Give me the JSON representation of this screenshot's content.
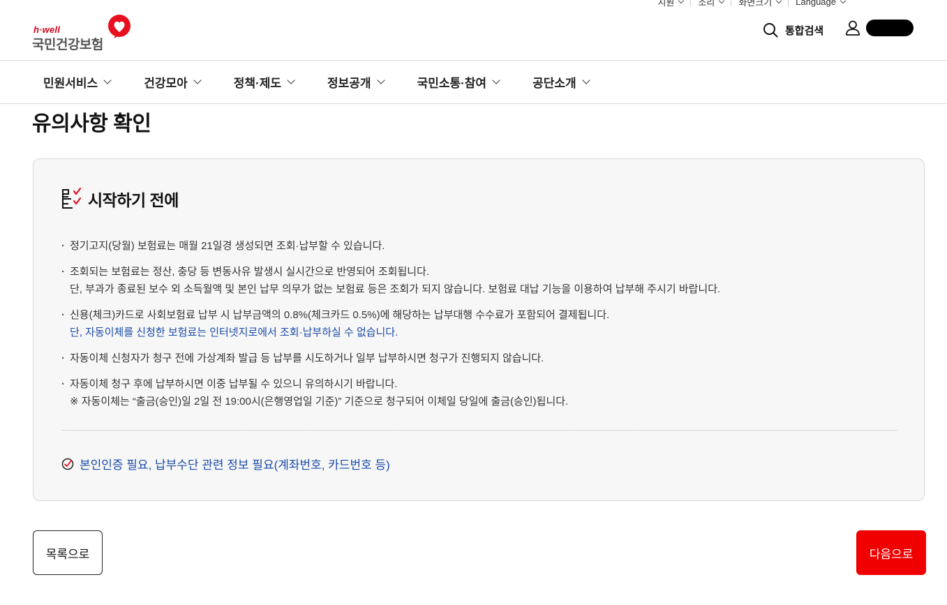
{
  "utility_bar": [
    {
      "label": "지원"
    },
    {
      "label": "소리"
    },
    {
      "label": "화면크기"
    },
    {
      "label": "Language"
    }
  ],
  "header": {
    "logo_brand": "h·well",
    "logo_org": "국민건강보험",
    "search_label": "통합검색"
  },
  "nav": {
    "items": [
      {
        "label": "민원서비스"
      },
      {
        "label": "건강모아"
      },
      {
        "label": "정책·제도"
      },
      {
        "label": "정보공개"
      },
      {
        "label": "국민소통·참여"
      },
      {
        "label": "공단소개"
      }
    ]
  },
  "page": {
    "title": "유의사항 확인"
  },
  "notice": {
    "heading": "시작하기 전에",
    "items": [
      {
        "lines": [
          "정기고지(당월) 보험료는 매월 21일경 생성되면 조회·납부할 수 있습니다."
        ]
      },
      {
        "lines": [
          "조회되는 보험료는 정산, 충당 등 변동사유 발생시 실시간으로 반영되어 조회됩니다.",
          "단, 부과가 종료된 보수 외 소득월액 및 본인 납무 의무가 없는 보험료 등은 조회가 되지 않습니다. 보험료 대납 기능을 이용하여 납부해 주시기 바랍니다."
        ]
      },
      {
        "lines": [
          "신용(체크)카드로 사회보험료 납부 시 납부금액의 0.8%(체크카드 0.5%)에 해당하는 납부대행 수수료가 포함되어 결제됩니다.",
          "단, 자동이체를 신청한 보험료는 인터넷지로에서 조회·납부하실 수 없습니다."
        ]
      },
      {
        "lines": [
          "자동이체 신청자가 청구 전에 가상계좌 발급 등 납부를 시도하거나 일부 납부하시면 청구가 진행되지 않습니다."
        ]
      },
      {
        "lines": [
          "자동이체 청구 후에 납부하시면 이중 납부될 수 있으니 유의하시기 바랍니다.",
          "※ 자동이체는 “출금(승인)일 2일 전 19:00시(은행영업일 기준)” 기준으로 청구되어 이체일 당일에 출금(승인)됩니다."
        ]
      }
    ],
    "requirement": "본인인증 필요, 납부수단 관련 정보 필요(계좌번호, 카드번호 등)"
  },
  "buttons": {
    "list": "목록으로",
    "next": "다음으로"
  },
  "colors": {
    "brand_red": "#f00000",
    "link_blue": "#1a4aa8",
    "panel_bg": "#f7f7f7"
  }
}
